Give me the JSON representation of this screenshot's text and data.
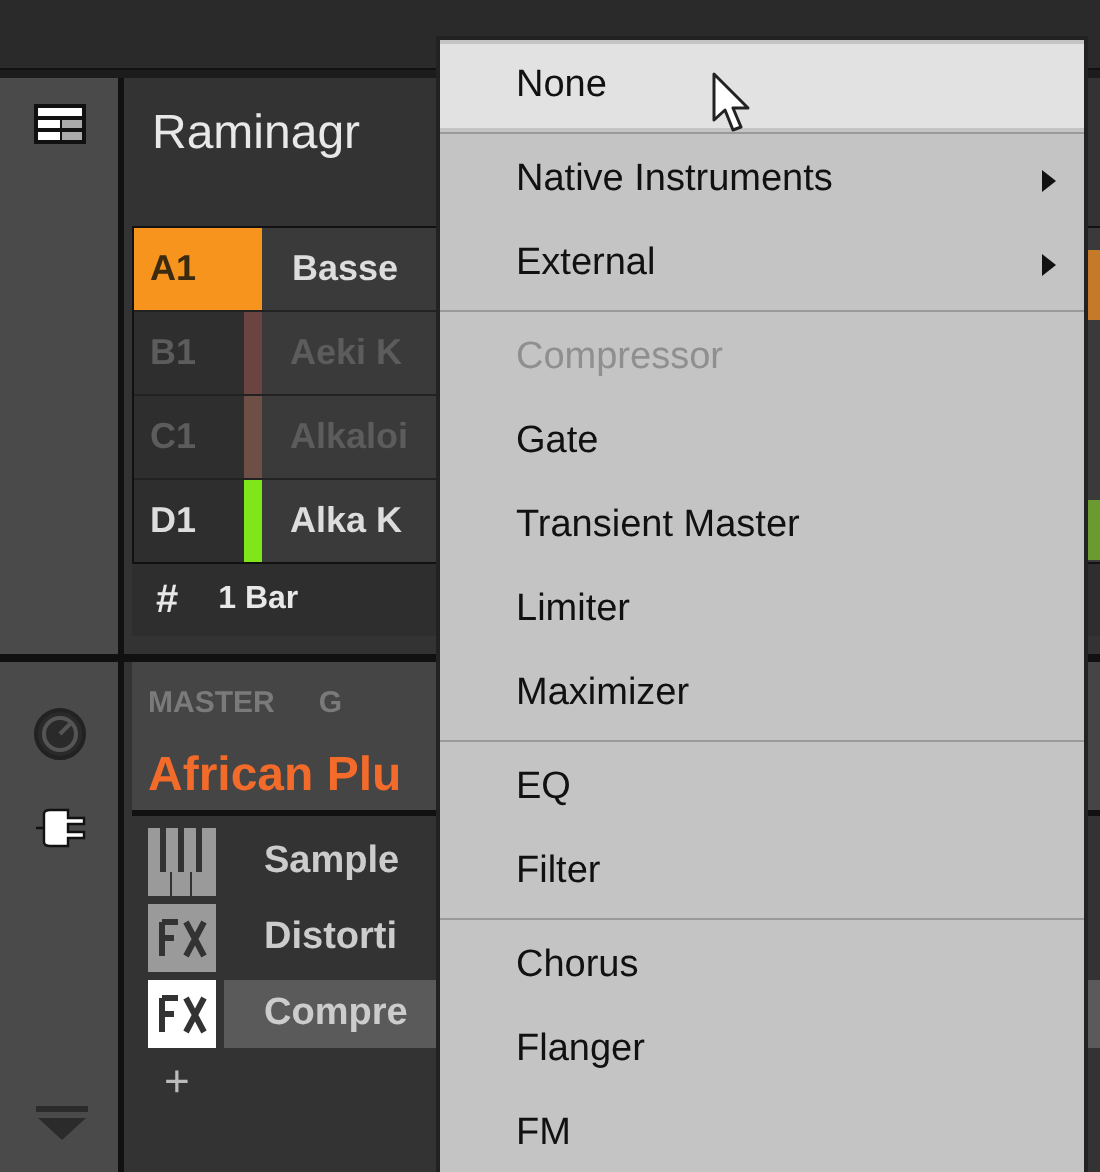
{
  "group_panel": {
    "title": "Raminagr",
    "patterns": [
      {
        "label": "A1",
        "name": "Basse",
        "color": "#f7941d",
        "selected": true,
        "dimmed": false
      },
      {
        "label": "B1",
        "name": "Aeki K",
        "color": "#6b4340",
        "selected": false,
        "dimmed": true
      },
      {
        "label": "C1",
        "name": "Alkaloi",
        "color": "#6e4f45",
        "selected": false,
        "dimmed": true
      },
      {
        "label": "D1",
        "name": "Alka K",
        "color": "#7fe61a",
        "selected": false,
        "dimmed": false
      }
    ],
    "length_icon": "#",
    "length": "1 Bar"
  },
  "sound_panel": {
    "tabs": [
      {
        "label": "MASTER",
        "selected": false
      },
      {
        "label": "G",
        "selected": false
      }
    ],
    "title": "African Plu",
    "sidebar": [
      {
        "kind": "knob",
        "selected": false
      },
      {
        "kind": "plug",
        "selected": true
      }
    ],
    "plugins": [
      {
        "kind": "instrument",
        "name": "Sample",
        "selected": false,
        "active": false
      },
      {
        "kind": "fx",
        "name": "Distorti",
        "selected": false,
        "active": false
      },
      {
        "kind": "fx",
        "name": "Compre",
        "selected": true,
        "active": true
      }
    ],
    "add": "+"
  },
  "menu": {
    "groups": [
      [
        {
          "label": "None",
          "selected": true,
          "disabled": false,
          "submenu": false
        }
      ],
      [
        {
          "label": "Native Instruments",
          "selected": false,
          "disabled": false,
          "submenu": true
        },
        {
          "label": "External",
          "selected": false,
          "disabled": false,
          "submenu": true
        }
      ],
      [
        {
          "label": "Compressor",
          "selected": false,
          "disabled": true,
          "submenu": false
        },
        {
          "label": "Gate",
          "selected": false,
          "disabled": false,
          "submenu": false
        },
        {
          "label": "Transient Master",
          "selected": false,
          "disabled": false,
          "submenu": false
        },
        {
          "label": "Limiter",
          "selected": false,
          "disabled": false,
          "submenu": false
        },
        {
          "label": "Maximizer",
          "selected": false,
          "disabled": false,
          "submenu": false
        }
      ],
      [
        {
          "label": "EQ",
          "selected": false,
          "disabled": false,
          "submenu": false
        },
        {
          "label": "Filter",
          "selected": false,
          "disabled": false,
          "submenu": false
        }
      ],
      [
        {
          "label": "Chorus",
          "selected": false,
          "disabled": false,
          "submenu": false
        },
        {
          "label": "Flanger",
          "selected": false,
          "disabled": false,
          "submenu": false
        },
        {
          "label": "FM",
          "selected": false,
          "disabled": false,
          "submenu": false
        }
      ]
    ]
  }
}
